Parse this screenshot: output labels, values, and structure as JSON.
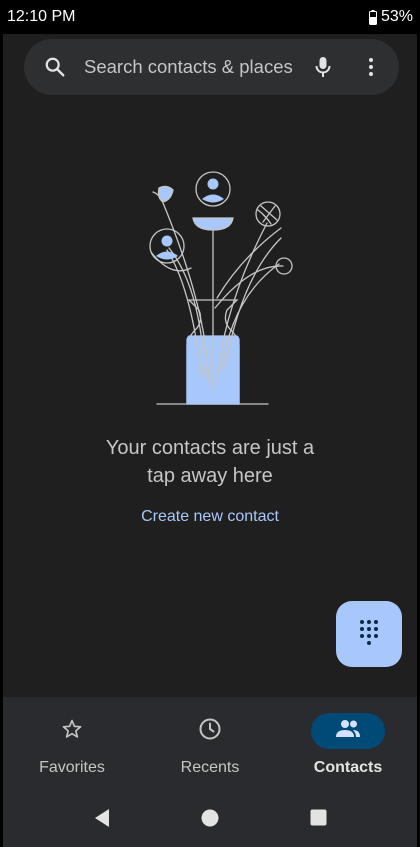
{
  "status_bar": {
    "time": "12:10 PM",
    "battery": "53%"
  },
  "search": {
    "placeholder": "Search contacts & places"
  },
  "empty_state": {
    "line1": "Your contacts are just a",
    "line2": "tap away here",
    "create_link": "Create new contact"
  },
  "bottom_nav": {
    "items": [
      {
        "label": "Favorites",
        "icon": "star-icon",
        "active": false
      },
      {
        "label": "Recents",
        "icon": "clock-icon",
        "active": false
      },
      {
        "label": "Contacts",
        "icon": "people-icon",
        "active": true
      }
    ]
  },
  "colors": {
    "background": "#1f1f1f",
    "accent": "#a8c7fa",
    "active_pill": "#004a77",
    "nav_background": "#2a2b2e"
  }
}
